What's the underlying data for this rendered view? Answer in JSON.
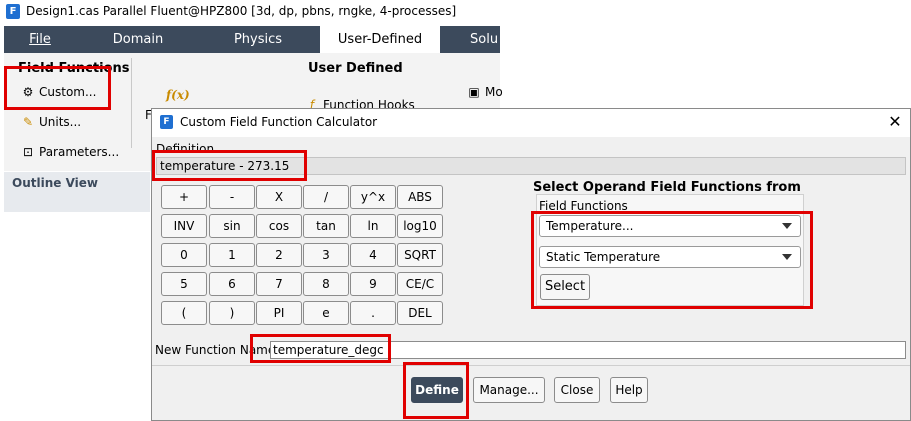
{
  "window": {
    "app_icon": "F",
    "title": "Design1.cas Parallel Fluent@HPZ800  [3d, dp, pbns, rngke, 4-processes]"
  },
  "ribbon": {
    "tabs": [
      "File",
      "Domain",
      "Physics",
      "User-Defined",
      "Solu"
    ],
    "active_tab": "User-Defined",
    "field_functions": {
      "group_title": "Field Functions",
      "buttons": [
        "Custom...",
        "Units...",
        "Parameters..."
      ],
      "icons": [
        "gear-icon",
        "pencil-icon",
        "parameters-icon"
      ]
    },
    "user_defined": {
      "group_title": "User Defined",
      "fx_icon": "f(x)",
      "function_hooks": "Function Hooks",
      "truncated_item": "Mo",
      "truncated_letter": "F"
    }
  },
  "outline_view": {
    "title": "Outline View"
  },
  "dialog": {
    "title": "Custom Field Function Calculator",
    "definition_label": "Definition",
    "definition_value": "temperature - 273.15",
    "keypad": [
      [
        "+",
        "-",
        "X",
        "/",
        "y^x",
        "ABS"
      ],
      [
        "INV",
        "sin",
        "cos",
        "tan",
        "ln",
        "log10"
      ],
      [
        "0",
        "1",
        "2",
        "3",
        "4",
        "SQRT"
      ],
      [
        "5",
        "6",
        "7",
        "8",
        "9",
        "CE/C"
      ],
      [
        "(",
        ")",
        "PI",
        "e",
        ".",
        "DEL"
      ]
    ],
    "operand": {
      "title": "Select Operand Field Functions from",
      "list_label": "Field Functions",
      "category": "Temperature...",
      "field": "Static Temperature",
      "select_label": "Select"
    },
    "new_function_label": "New Function Name",
    "new_function_value": "temperature_degc",
    "buttons": [
      "Define",
      "Manage...",
      "Close",
      "Help"
    ]
  },
  "colors": {
    "ribbon_dark": "#3c4a5c",
    "highlight_red": "#e00000",
    "fluent_blue": "#1f6fd1"
  }
}
